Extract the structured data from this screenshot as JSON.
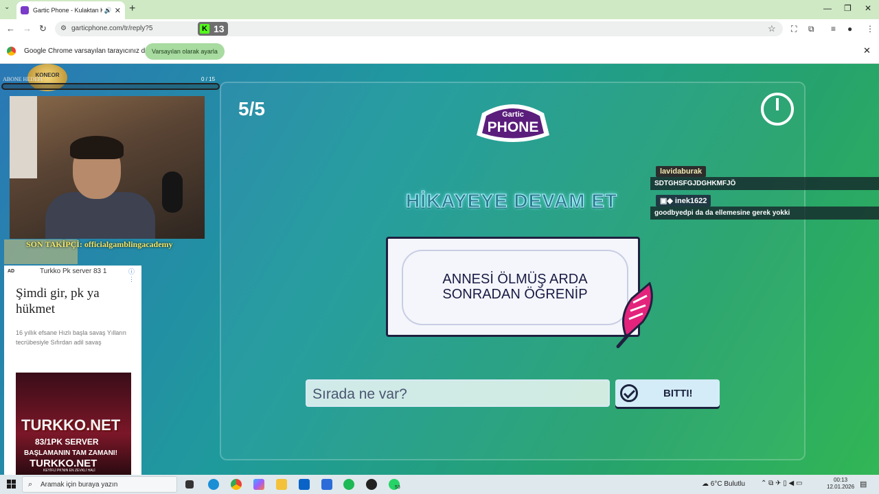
{
  "browser": {
    "tab_title": "Gartic Phone - Kulaktan Kul",
    "url": "garticphone.com/tr/reply?5",
    "kick_count": "13",
    "infobar_message": "Google Chrome varsayılan tarayıcınız değil",
    "infobar_button": "Varsayılan olarak ayarla"
  },
  "game": {
    "round": "5/5",
    "logo_top": "Gartic",
    "logo_main": "PHONE",
    "heading": "HİKAYEYE DEVAM ET",
    "prompt_text": "ANNESİ ÖLMÜŞ ARDA\nSONRADAN ÖĞRENİP",
    "input_placeholder": "Sırada ne var?",
    "done_button": "BITTI!"
  },
  "stream": {
    "goal_label": "ABONE HEDEFİ",
    "goal_logo": "KONEOR",
    "goal_count": "0 / 15",
    "follower_text": "SON TAKİPÇİ: officialgamblingacademy",
    "chat": [
      {
        "user": "lavidaburak",
        "text": "SDTGHSFGJDGHKMFJÖ"
      },
      {
        "user": "inek1622",
        "text": "goodbyedpi da da ellemesine gerek yokki"
      }
    ]
  },
  "ad": {
    "tag": "AD",
    "source": "Turkko Pk server 83 1",
    "headline": "Şimdi gir, pk ya hükmet",
    "body": "16 yıllık efsane Hızlı başla savaş Yılların tecrübesiyle Sıfırdan adil savaş",
    "img_brand": "TURKKO.NET",
    "img_line2": "83/1PK SERVER",
    "img_line3": "BAŞLAMANIN TAM ZAMANI!",
    "img_line4": "TURKKO.NET",
    "img_line5": "KEYİFLİ PK'NIN EN ZEVKLİ HALİ"
  },
  "taskbar": {
    "search_placeholder": "Aramak için buraya yazın",
    "weather": "6°C  Bulutlu",
    "time": "00:13",
    "date": "12.01.2026",
    "whatsapp_badge": "53"
  },
  "colors": {
    "accent_green": "#53fc18",
    "game_heading": "#2a7b8f",
    "card_border": "#1f2040"
  }
}
